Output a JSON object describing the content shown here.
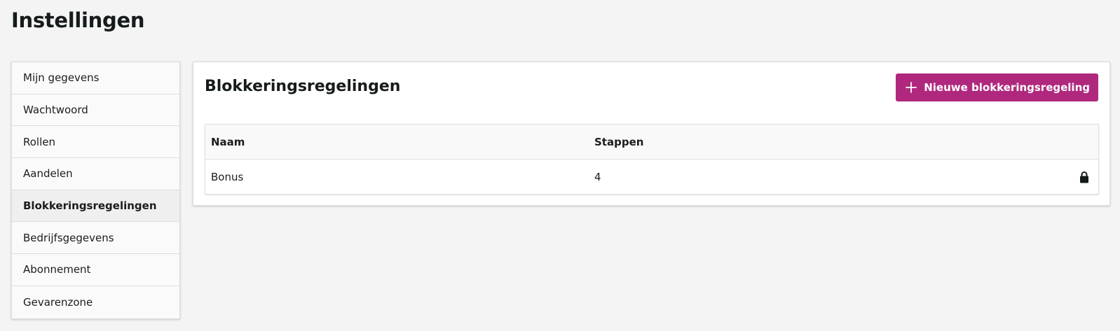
{
  "page": {
    "title": "Instellingen"
  },
  "sidebar": {
    "items": [
      {
        "label": "Mijn gegevens"
      },
      {
        "label": "Wachtwoord"
      },
      {
        "label": "Rollen"
      },
      {
        "label": "Aandelen"
      },
      {
        "label": "Blokkeringsregelingen",
        "active": true
      },
      {
        "label": "Bedrijfsgegevens"
      },
      {
        "label": "Abonnement"
      },
      {
        "label": "Gevarenzone"
      }
    ]
  },
  "main": {
    "title": "Blokkeringsregelingen",
    "new_button_label": "Nieuwe blokkeringsregeling",
    "new_button_icon": "plus-icon",
    "table": {
      "columns": [
        "Naam",
        "Stappen"
      ],
      "rows": [
        {
          "name": "Bonus",
          "steps": "4",
          "icon": "lock-icon"
        }
      ]
    }
  },
  "colors": {
    "accent": "#b0287e",
    "background": "#f4f4f4",
    "panel": "#ffffff"
  }
}
